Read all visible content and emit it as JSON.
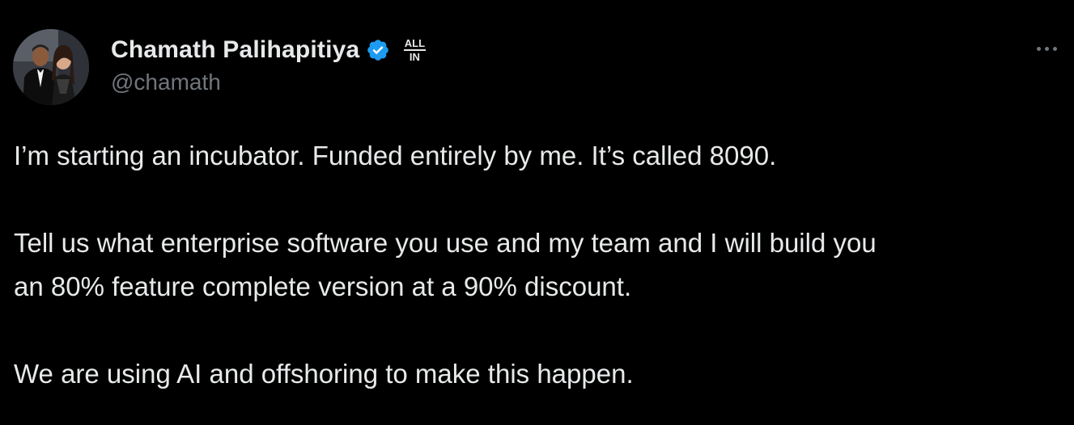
{
  "author": {
    "display_name": "Chamath Palihapitiya",
    "handle": "@chamath",
    "affiliate_badge_line1": "ALL",
    "affiliate_badge_line2": "IN",
    "verified_color": "#1d9bf0"
  },
  "tweet": {
    "lines": [
      "I’m starting an incubator. Funded entirely by me. It’s called 8090.",
      "Tell us what enterprise software you use and my team and I will build you",
      "an 80% feature complete version at a 90% discount.",
      "We are using AI and offshoring to make this happen."
    ]
  },
  "colors": {
    "background": "#000000",
    "text": "#e7e9ea",
    "secondary_text": "#71767b"
  },
  "icons": {
    "avatar": "profile-photo",
    "verified": "verified-badge-icon",
    "more": "more-options-icon"
  }
}
